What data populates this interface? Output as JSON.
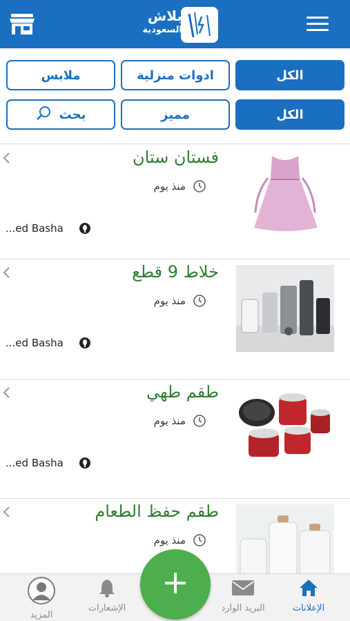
{
  "colors": {
    "brand": "#1a6fc0",
    "title_green": "#2e7d32",
    "fab_green": "#4cae4c"
  },
  "header": {
    "logo_name": "بلاش",
    "logo_sub": "السعودية",
    "left_icon": "store-icon",
    "right_icon": "menu-icon"
  },
  "filters": {
    "row1": [
      {
        "label": "الكل",
        "active": true
      },
      {
        "label": "ادوات منزلية",
        "active": false
      },
      {
        "label": "ملابس",
        "active": false
      }
    ],
    "row2": [
      {
        "label": "الكل",
        "active": true
      },
      {
        "label": "مميز",
        "active": false
      },
      {
        "label": "بحث",
        "active": false,
        "icon": "search-icon"
      }
    ]
  },
  "listings": [
    {
      "title": "فستان ستان",
      "time": "منذ يوم",
      "seller": "...ed Basha",
      "image": "pink-dress"
    },
    {
      "title": "خلاط 9 قطع",
      "time": "منذ يوم",
      "seller": "...ed Basha",
      "image": "kitchen-appliances"
    },
    {
      "title": "طقم طهي",
      "time": "منذ يوم",
      "seller": "...ed Basha",
      "image": "red-cookware-set"
    },
    {
      "title": "طقم حفظ الطعام",
      "time": "منذ يوم",
      "seller": "",
      "image": "food-storage-jars"
    }
  ],
  "bottom_nav": {
    "ads": {
      "label": "الإعلانات",
      "icon": "home-icon",
      "active": true
    },
    "inbox": {
      "label": "البريد الوارد",
      "icon": "mail-icon"
    },
    "add": {
      "icon": "plus-icon"
    },
    "notifications": {
      "label": "الإشعارات",
      "icon": "bell-icon"
    },
    "more": {
      "label": "المزيد",
      "icon": "avatar-icon"
    }
  }
}
